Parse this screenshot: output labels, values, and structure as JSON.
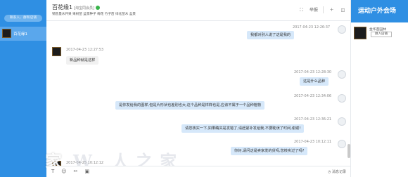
{
  "sidebar": {
    "search_placeholder": "联系人、群和店铺",
    "contact": {
      "name": "百花缘1"
    }
  },
  "watermark": {
    "text": "家",
    "ghost": "W 人之家"
  },
  "header": {
    "title": "百花缘1",
    "title_sub": "[淘宝同会员]",
    "tags": "销售量水开果  果树苗  盆景种子  梅花  竹子苗  绿化苗木  盆景",
    "report_label": "举报"
  },
  "messages": [
    {
      "time": "2017-04-23 12:26:37",
      "text": "我都对别人说了这是我的",
      "dir": "out"
    },
    {
      "time": "2017-04-23 12:27:53",
      "text": "新品种就是这样",
      "dir": "in"
    },
    {
      "time": "2017-04-23 12:28:30",
      "text": "这是什么品种",
      "dir": "out"
    },
    {
      "time": "2017-04-23 12:34:06",
      "text": "是你发给我的图样,但是片形状也差别也大,这个品种是样样也是,应该不属于一个品种植物",
      "dir": "out"
    },
    {
      "time": "2017-04-23 12:36:21",
      "text": "请您核实一下,如果确实是发错了,请赶紧补发给我,不要耽误了时间,谢谢!",
      "dir": "out"
    },
    {
      "time": "2017-04-23 10:12:11",
      "text": "你好,请问这是卖家发的货吗,您核实过了吗?",
      "dir": "out"
    },
    {
      "time": "2017-04-25 10:12:12",
      "text": "",
      "dir": "in"
    }
  ],
  "toolbar": {
    "tools": [
      "T",
      "☺",
      "✂",
      "▣"
    ],
    "history_label": "消息记录"
  },
  "right_panel": {
    "banner": "运动户外会场",
    "shop_name": "金华苗园林",
    "shop_button": "进入店铺"
  }
}
